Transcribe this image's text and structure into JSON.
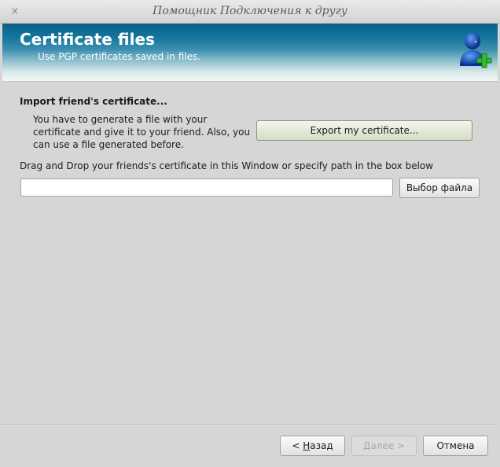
{
  "window": {
    "title": "Помощник Подключения к другу",
    "close_glyph": "×"
  },
  "banner": {
    "title": "Certificate files",
    "subtitle": "Use PGP certificates saved in files.",
    "icon": "user-add-icon"
  },
  "import": {
    "heading": "Import friend's certificate...",
    "info_text": "You have to generate a file with your certificate and give it to your friend. Also, you can use a file generated before.",
    "export_button": "Export my certificate...",
    "dnd_text": "Drag and Drop your friends's certificate in this Window or specify path in the box below",
    "path_value": "",
    "browse_button": "Выбор файла"
  },
  "footer": {
    "back_prefix": "< ",
    "back_mnemonic": "Н",
    "back_rest": "азад",
    "next_prefix": "",
    "next_mnemonic": "Д",
    "next_rest": "алее >",
    "cancel_button": "Отмена"
  }
}
